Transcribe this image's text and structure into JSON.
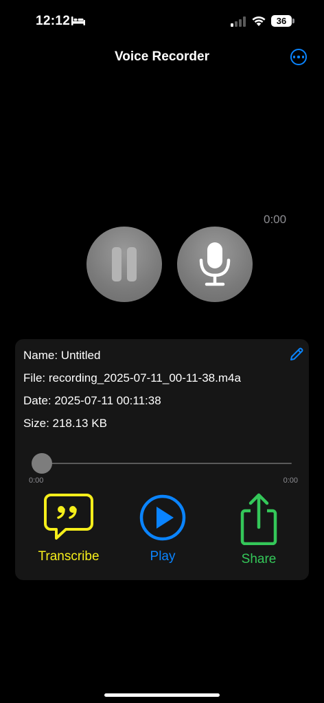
{
  "status_bar": {
    "time": "12:12",
    "battery": "36",
    "icons": [
      "bed-icon",
      "cellular-signal-icon",
      "wifi-icon",
      "battery-icon"
    ]
  },
  "nav": {
    "title": "Voice Recorder",
    "more_icon": "ellipsis-circle-icon"
  },
  "recorder": {
    "timer": "0:00",
    "pause_icon": "pause-icon",
    "mic_icon": "microphone-icon"
  },
  "recording_info": {
    "name": "Name: Untitled",
    "file": "File: recording_2025-07-11_00-11-38.m4a",
    "date": "Date: 2025-07-11 00:11:38",
    "size": "Size: 218.13 KB",
    "edit_icon": "pencil-icon"
  },
  "playback": {
    "current_time": "0:00",
    "duration": "0:00",
    "progress": 0
  },
  "actions": {
    "transcribe_label": "Transcribe",
    "play_label": "Play",
    "share_label": "Share"
  },
  "colors": {
    "accent_blue": "#0a84ff",
    "transcribe_yellow": "#f5ee1b",
    "share_green": "#34c759",
    "card_background": "#161616"
  }
}
